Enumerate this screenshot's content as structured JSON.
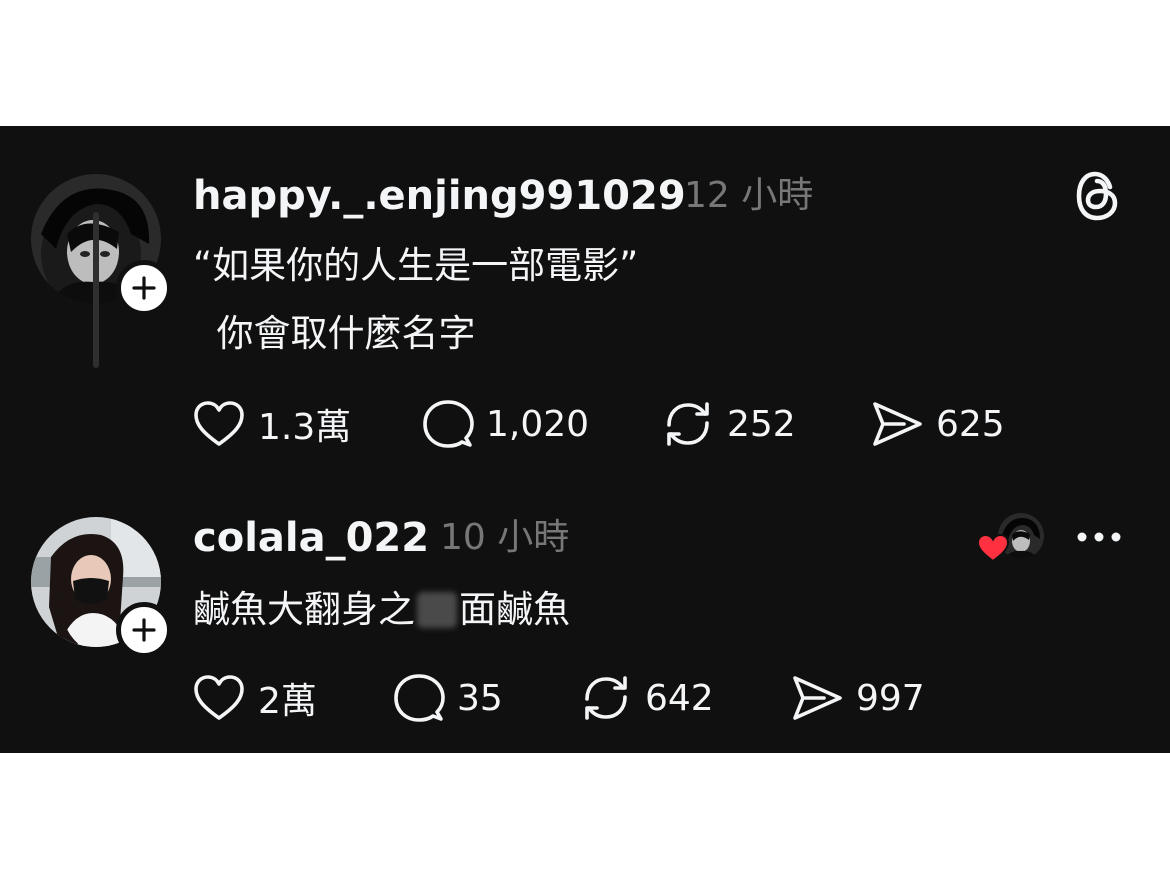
{
  "app": {
    "name": "Threads"
  },
  "posts": [
    {
      "username": "happy._.enjing991029",
      "time": "12 小時",
      "text_line1": "“如果你的人生是一部電影”",
      "text_line2": "  你會取什麼名字",
      "likes": "1.3萬",
      "replies": "1,020",
      "reposts": "252",
      "shares": "625"
    },
    {
      "username": "colala_022",
      "time": "10 小時",
      "text": "鹹魚大翻身之",
      "text_tail": "面鹹魚",
      "likes": "2萬",
      "replies": "35",
      "reposts": "642",
      "shares": "997"
    }
  ],
  "icons": {
    "threads_logo": "threads-logo-icon",
    "follow": "plus-icon",
    "like": "heart-icon",
    "reply": "comment-icon",
    "repost": "repost-icon",
    "share": "send-icon",
    "more": "more-icon",
    "liked_by_author": "heart-icon"
  },
  "colors": {
    "background": "#101010",
    "text": "#f3f5f7",
    "muted": "#777777",
    "heart": "#ff3040"
  }
}
